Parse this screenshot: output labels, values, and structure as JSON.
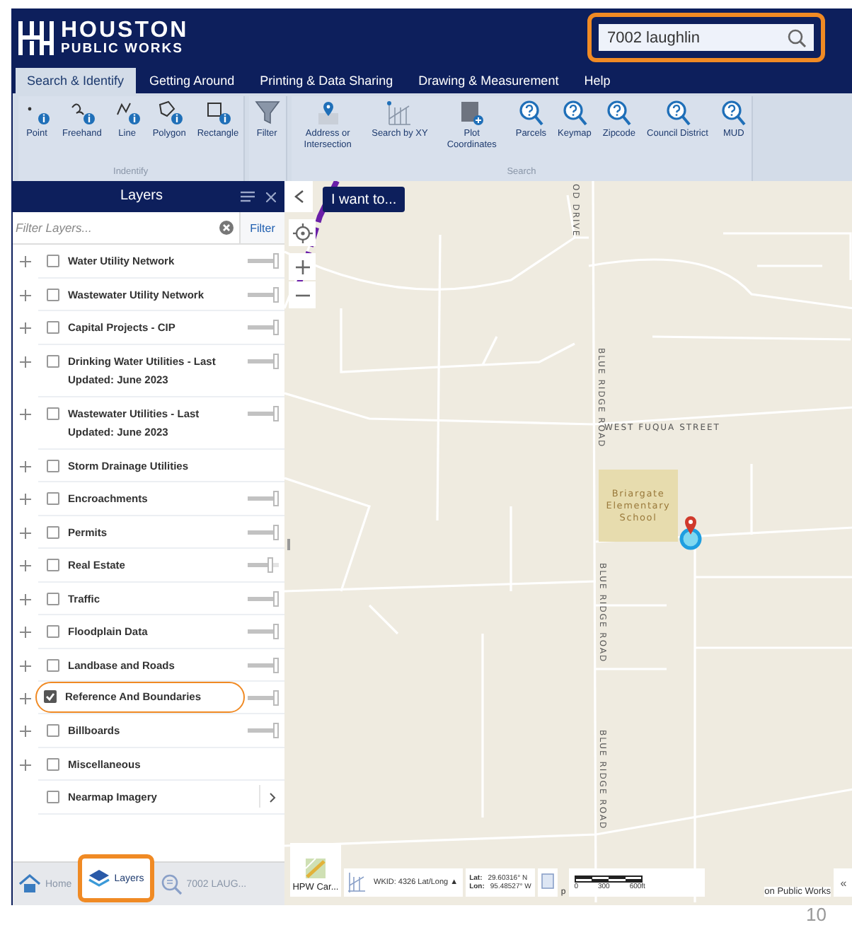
{
  "header": {
    "logo_line1": "HOUSTON",
    "logo_line2": "PUBLIC WORKS",
    "search": {
      "value": "7002 laughlin",
      "highlighted": true
    }
  },
  "tabs": [
    {
      "label": "Search & Identify",
      "selected": true
    },
    {
      "label": "Getting Around",
      "selected": false
    },
    {
      "label": "Printing & Data Sharing",
      "selected": false
    },
    {
      "label": "Drawing & Measurement",
      "selected": false
    },
    {
      "label": "Help",
      "selected": false
    }
  ],
  "ribbon": {
    "groups": [
      {
        "title": "Indentify",
        "tools": [
          {
            "label": "Point",
            "kind": "point"
          },
          {
            "label": "Freehand",
            "kind": "freehand"
          },
          {
            "label": "Line",
            "kind": "line"
          },
          {
            "label": "Polygon",
            "kind": "polygon"
          },
          {
            "label": "Rectangle",
            "kind": "rectangle"
          }
        ]
      },
      {
        "tools": [
          {
            "label": "Filter",
            "kind": "filter"
          }
        ]
      },
      {
        "title": "Search",
        "tools": [
          {
            "label": "Address or Intersection",
            "kind": "address"
          },
          {
            "label": "Search by XY",
            "kind": "xy"
          },
          {
            "label": "Plot Coordinates",
            "kind": "plot"
          },
          {
            "label": "Parcels",
            "kind": "query"
          },
          {
            "label": "Keymap",
            "kind": "query"
          },
          {
            "label": "Zipcode",
            "kind": "query"
          },
          {
            "label": "Council District",
            "kind": "query"
          },
          {
            "label": "MUD",
            "kind": "query"
          }
        ]
      }
    ]
  },
  "layers_panel": {
    "title": "Layers",
    "filter": {
      "placeholder": "Filter Layers...",
      "button": "Filter"
    },
    "layers": [
      {
        "label": "Water Utility Network",
        "kind": "group",
        "checked": false,
        "level": 1
      },
      {
        "label": "Wastewater Utility Network",
        "kind": "group",
        "checked": false,
        "level": 1
      },
      {
        "label": "Capital Projects - CIP",
        "kind": "group",
        "checked": false,
        "level": 1
      },
      {
        "label": "Drinking Water Utilities - Last Updated: June 2023",
        "kind": "group",
        "checked": false,
        "level": 1
      },
      {
        "label": "Wastewater Utilities - Last Updated: June 2023",
        "kind": "group",
        "checked": false,
        "level": 1
      },
      {
        "label": "Storm Drainage Utilities",
        "kind": "group",
        "checked": false
      },
      {
        "label": "Encroachments",
        "kind": "group",
        "checked": false,
        "level": 1
      },
      {
        "label": "Permits",
        "kind": "group",
        "checked": false,
        "level": 1
      },
      {
        "label": "Real Estate",
        "kind": "group",
        "checked": false,
        "level": 0.8
      },
      {
        "label": "Traffic",
        "kind": "group",
        "checked": false,
        "level": 1
      },
      {
        "label": "Floodplain Data",
        "kind": "group",
        "checked": false,
        "level": 1
      },
      {
        "label": "Landbase and Roads",
        "kind": "group",
        "checked": false,
        "level": 1
      },
      {
        "label": "Reference And Boundaries",
        "kind": "group",
        "checked": true,
        "level": 1,
        "highlighted": true
      },
      {
        "label": "Billboards",
        "kind": "group",
        "checked": false,
        "level": 1
      },
      {
        "label": "Miscellaneous",
        "kind": "group",
        "checked": false
      },
      {
        "label": "Nearmap Imagery",
        "kind": "basemap",
        "checked": false
      }
    ],
    "bottom_tabs": [
      {
        "label": "Home",
        "kind": "home",
        "selected": false
      },
      {
        "label": "Layers",
        "kind": "layers",
        "selected": true,
        "highlighted": true
      },
      {
        "label": "7002 LAUG...",
        "kind": "results",
        "selected": false
      }
    ]
  },
  "map": {
    "i_want_to": "I want to...",
    "street_labels": [
      "OD DRIVE",
      "BLUE RIDGE ROAD",
      "WEST FUQUA STREET",
      "BLUE RIDGE ROAD",
      "BLUE RIDGE ROAD"
    ],
    "school_label": [
      "Briargate",
      "Elementary",
      "School"
    ],
    "basemap_button": "HPW Car...",
    "coordinate_system": "WKID: 4326 Lat/Long ▲",
    "lat_label": "Lat:",
    "lat_value": "29.60316° N",
    "lon_label": "Lon:",
    "lon_value": "95.48527° W",
    "attribution_start": "p",
    "scale_ticks": [
      "0",
      "300",
      "600ft"
    ],
    "attribution_end": "on Public Works",
    "collapse": "«"
  },
  "page_number": "10"
}
